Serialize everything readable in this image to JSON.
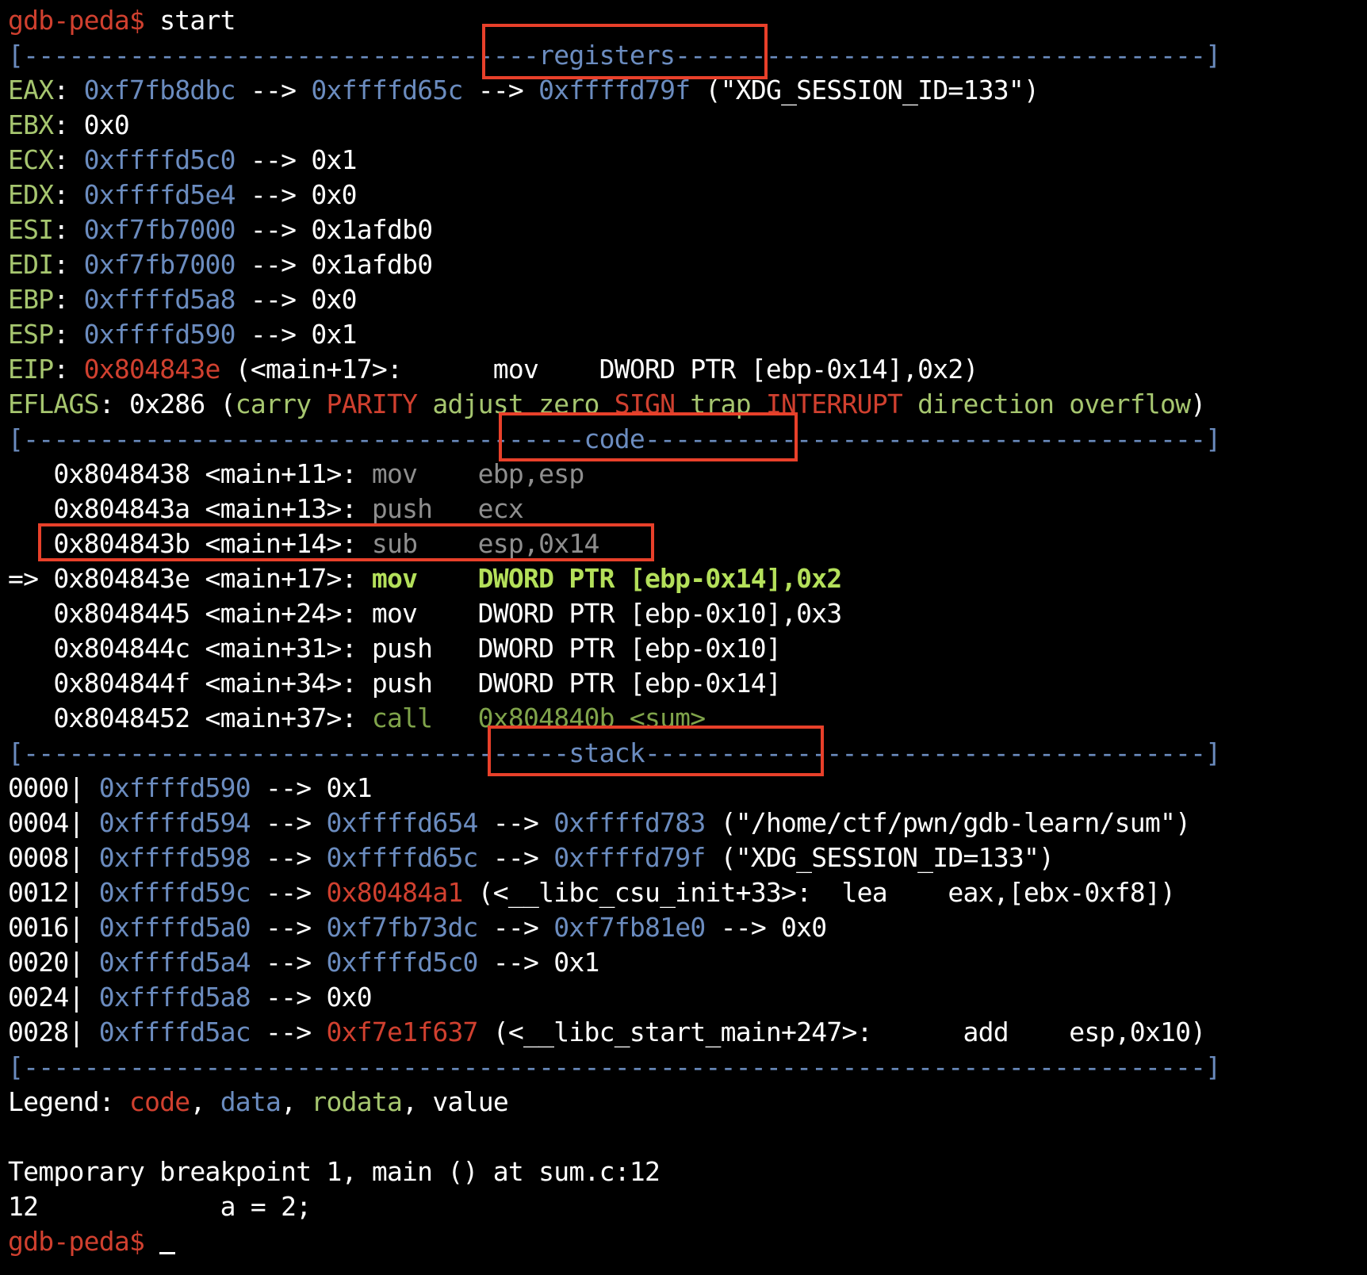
{
  "colors": {
    "background": "#000000",
    "code": "#d0402f",
    "data": "#6b8cbf",
    "rodata": "#a6c66f",
    "value": "#ffffff",
    "highlight_box": "#e8402a"
  },
  "lines": [
    [
      [
        "c-prompt",
        "gdb-peda$ "
      ],
      [
        "c-white",
        "start"
      ]
    ],
    [
      [
        "c-blue",
        "[----------------------------------registers-----------------------------------]"
      ]
    ],
    [
      [
        "c-green",
        "EAX"
      ],
      [
        "c-white",
        ": "
      ],
      [
        "c-blue",
        "0xf7fb8dbc"
      ],
      [
        "c-white",
        " --> "
      ],
      [
        "c-blue",
        "0xffffd65c"
      ],
      [
        "c-white",
        " --> "
      ],
      [
        "c-blue",
        "0xffffd79f"
      ],
      [
        "c-white",
        " (\"XDG_SESSION_ID=133\")"
      ]
    ],
    [
      [
        "c-green",
        "EBX"
      ],
      [
        "c-white",
        ": 0x0"
      ]
    ],
    [
      [
        "c-green",
        "ECX"
      ],
      [
        "c-white",
        ": "
      ],
      [
        "c-blue",
        "0xffffd5c0"
      ],
      [
        "c-white",
        " --> 0x1"
      ]
    ],
    [
      [
        "c-green",
        "EDX"
      ],
      [
        "c-white",
        ": "
      ],
      [
        "c-blue",
        "0xffffd5e4"
      ],
      [
        "c-white",
        " --> 0x0"
      ]
    ],
    [
      [
        "c-green",
        "ESI"
      ],
      [
        "c-white",
        ": "
      ],
      [
        "c-blue",
        "0xf7fb7000"
      ],
      [
        "c-white",
        " --> 0x1afdb0"
      ]
    ],
    [
      [
        "c-green",
        "EDI"
      ],
      [
        "c-white",
        ": "
      ],
      [
        "c-blue",
        "0xf7fb7000"
      ],
      [
        "c-white",
        " --> 0x1afdb0"
      ]
    ],
    [
      [
        "c-green",
        "EBP"
      ],
      [
        "c-white",
        ": "
      ],
      [
        "c-blue",
        "0xffffd5a8"
      ],
      [
        "c-white",
        " --> 0x0"
      ]
    ],
    [
      [
        "c-green",
        "ESP"
      ],
      [
        "c-white",
        ": "
      ],
      [
        "c-blue",
        "0xffffd590"
      ],
      [
        "c-white",
        " --> 0x1"
      ]
    ],
    [
      [
        "c-green",
        "EIP"
      ],
      [
        "c-white",
        ": "
      ],
      [
        "c-red",
        "0x804843e"
      ],
      [
        "c-white",
        " (<main+17>:      mov    DWORD PTR [ebp-0x14],0x2)"
      ]
    ],
    [
      [
        "c-green",
        "EFLAGS"
      ],
      [
        "c-white",
        ": 0x286 ("
      ],
      [
        "c-green",
        "carry "
      ],
      [
        "c-red",
        "PARITY "
      ],
      [
        "c-green",
        "adjust zero "
      ],
      [
        "c-red",
        "SIGN "
      ],
      [
        "c-green",
        "trap "
      ],
      [
        "c-red",
        "INTERRUPT "
      ],
      [
        "c-green",
        "direction overflow"
      ],
      [
        "c-white",
        ")"
      ]
    ],
    [
      [
        "c-blue",
        "[-------------------------------------code-------------------------------------]"
      ]
    ],
    [
      [
        "c-white",
        "   0x8048438 <main+11>: "
      ],
      [
        "c-gray",
        "mov    ebp,esp"
      ]
    ],
    [
      [
        "c-white",
        "   0x804843a <main+13>: "
      ],
      [
        "c-gray",
        "push   ecx"
      ]
    ],
    [
      [
        "c-white",
        "   0x804843b <main+14>: "
      ],
      [
        "c-gray",
        "sub    esp,0x14"
      ]
    ],
    [
      [
        "c-white",
        "=> 0x804843e <main+17>: "
      ],
      [
        "c-bgreen",
        "mov    DWORD PTR [ebp-0x14],0x2"
      ]
    ],
    [
      [
        "c-white",
        "   0x8048445 <main+24>: mov    DWORD PTR [ebp-0x10],0x3"
      ]
    ],
    [
      [
        "c-white",
        "   0x804844c <main+31>: push   DWORD PTR [ebp-0x10]"
      ]
    ],
    [
      [
        "c-white",
        "   0x804844f <main+34>: push   DWORD PTR [ebp-0x14]"
      ]
    ],
    [
      [
        "c-white",
        "   0x8048452 <main+37>: "
      ],
      [
        "c-dgreen",
        "call   0x804840b <sum>"
      ]
    ],
    [
      [
        "c-blue",
        "[------------------------------------stack-------------------------------------]"
      ]
    ],
    [
      [
        "c-white",
        "0000| "
      ],
      [
        "c-blue",
        "0xffffd590"
      ],
      [
        "c-white",
        " --> 0x1"
      ]
    ],
    [
      [
        "c-white",
        "0004| "
      ],
      [
        "c-blue",
        "0xffffd594"
      ],
      [
        "c-white",
        " --> "
      ],
      [
        "c-blue",
        "0xffffd654"
      ],
      [
        "c-white",
        " --> "
      ],
      [
        "c-blue",
        "0xffffd783"
      ],
      [
        "c-white",
        " (\"/home/ctf/pwn/gdb-learn/sum\")"
      ]
    ],
    [
      [
        "c-white",
        "0008| "
      ],
      [
        "c-blue",
        "0xffffd598"
      ],
      [
        "c-white",
        " --> "
      ],
      [
        "c-blue",
        "0xffffd65c"
      ],
      [
        "c-white",
        " --> "
      ],
      [
        "c-blue",
        "0xffffd79f"
      ],
      [
        "c-white",
        " (\"XDG_SESSION_ID=133\")"
      ]
    ],
    [
      [
        "c-white",
        "0012| "
      ],
      [
        "c-blue",
        "0xffffd59c"
      ],
      [
        "c-white",
        " --> "
      ],
      [
        "c-red",
        "0x80484a1"
      ],
      [
        "c-white",
        " (<__libc_csu_init+33>:  lea    eax,[ebx-0xf8])"
      ]
    ],
    [
      [
        "c-white",
        "0016| "
      ],
      [
        "c-blue",
        "0xffffd5a0"
      ],
      [
        "c-white",
        " --> "
      ],
      [
        "c-blue",
        "0xf7fb73dc"
      ],
      [
        "c-white",
        " --> "
      ],
      [
        "c-blue",
        "0xf7fb81e0"
      ],
      [
        "c-white",
        " --> 0x0"
      ]
    ],
    [
      [
        "c-white",
        "0020| "
      ],
      [
        "c-blue",
        "0xffffd5a4"
      ],
      [
        "c-white",
        " --> "
      ],
      [
        "c-blue",
        "0xffffd5c0"
      ],
      [
        "c-white",
        " --> 0x1"
      ]
    ],
    [
      [
        "c-white",
        "0024| "
      ],
      [
        "c-blue",
        "0xffffd5a8"
      ],
      [
        "c-white",
        " --> 0x0"
      ]
    ],
    [
      [
        "c-white",
        "0028| "
      ],
      [
        "c-blue",
        "0xffffd5ac"
      ],
      [
        "c-white",
        " --> "
      ],
      [
        "c-red",
        "0xf7e1f637"
      ],
      [
        "c-white",
        " (<__libc_start_main+247>:      add    esp,0x10)"
      ]
    ],
    [
      [
        "c-blue",
        "[------------------------------------------------------------------------------]"
      ]
    ],
    [
      [
        "c-white",
        "Legend: "
      ],
      [
        "c-red",
        "code"
      ],
      [
        "c-white",
        ", "
      ],
      [
        "c-blue",
        "data"
      ],
      [
        "c-white",
        ", "
      ],
      [
        "c-green",
        "rodata"
      ],
      [
        "c-white",
        ", value"
      ]
    ],
    [
      [
        "c-white",
        " "
      ]
    ],
    [
      [
        "c-white",
        "Temporary breakpoint 1, main () at sum.c:12"
      ]
    ],
    [
      [
        "c-white",
        "12            a = 2;"
      ]
    ],
    [
      [
        "c-prompt",
        "gdb-peda$ "
      ]
    ]
  ]
}
